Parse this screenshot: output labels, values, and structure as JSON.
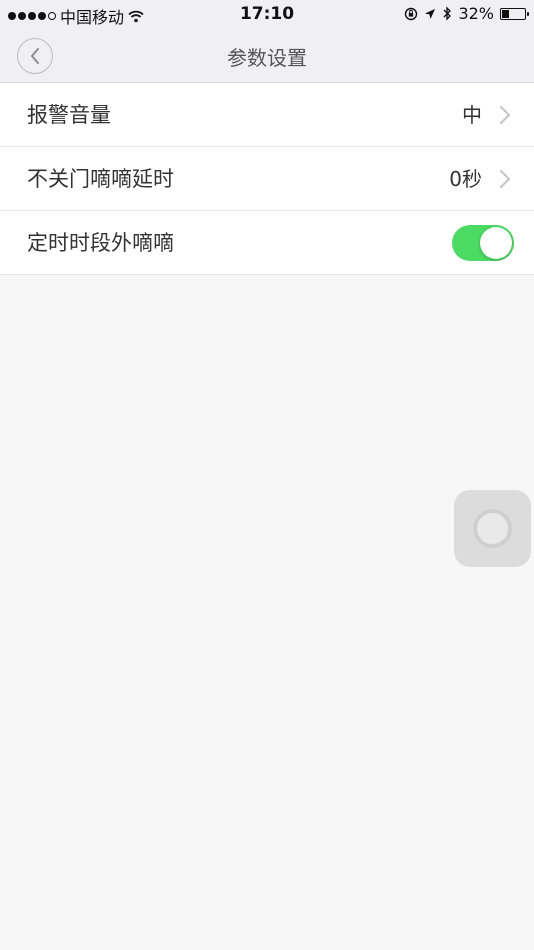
{
  "status_bar": {
    "carrier": "中国移动",
    "time": "17:10",
    "battery_percent": "32%",
    "battery_level": 0.32,
    "signal_strength": 4,
    "signal_max": 5,
    "icons": [
      "signal-dots-icon",
      "wifi-icon",
      "orientation-lock-icon",
      "location-arrow-icon",
      "bluetooth-icon",
      "battery-icon"
    ]
  },
  "nav": {
    "title": "参数设置",
    "back_icon": "chevron-left-icon"
  },
  "settings": [
    {
      "label": "报警音量",
      "value": "中",
      "control": "disclosure"
    },
    {
      "label": "不关门嘀嘀延时",
      "value": "0秒",
      "control": "disclosure"
    },
    {
      "label": "定时时段外嘀嘀",
      "control": "toggle",
      "on": true
    }
  ],
  "colors": {
    "toggle_on": "#4cd964",
    "nav_background": "#efeff4",
    "page_background": "#f7f7f7"
  }
}
